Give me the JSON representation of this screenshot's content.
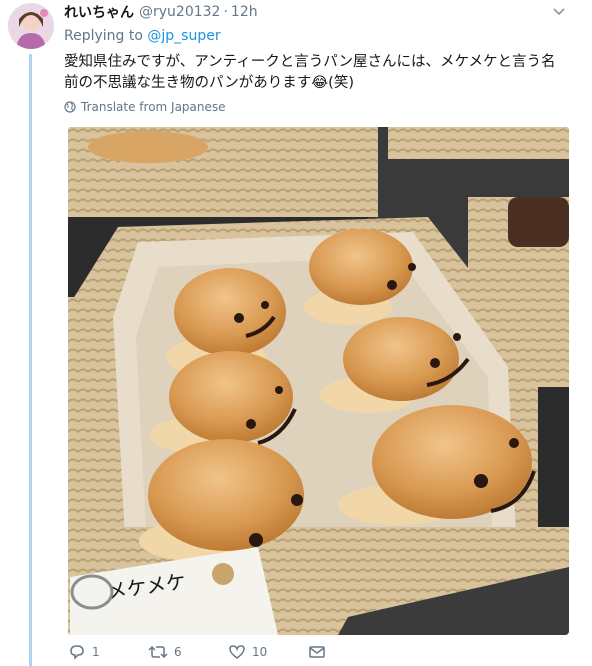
{
  "tweet": {
    "display_name": "れいちゃん",
    "handle": "@ryu20132",
    "separator": "·",
    "time": "12h",
    "replying_label": "Replying to",
    "replying_to": "@jp_super",
    "text": "愛知県住みですが、アンティークと言うパン屋さんには、メケメケと言う名前の不思議な生き物のパンがあります😂(笑)",
    "translate_label": "Translate from Japanese",
    "photo_card_text": "メケメケ"
  },
  "actions": {
    "reply_count": "1",
    "retweet_count": "6",
    "like_count": "10"
  },
  "colors": {
    "link": "#1b95e0",
    "muted": "#657786",
    "thread_line": "#aed4f1"
  },
  "icons": [
    "avatar",
    "chevron-down-icon",
    "globe-icon",
    "reply-icon",
    "retweet-icon",
    "like-icon",
    "message-icon"
  ]
}
